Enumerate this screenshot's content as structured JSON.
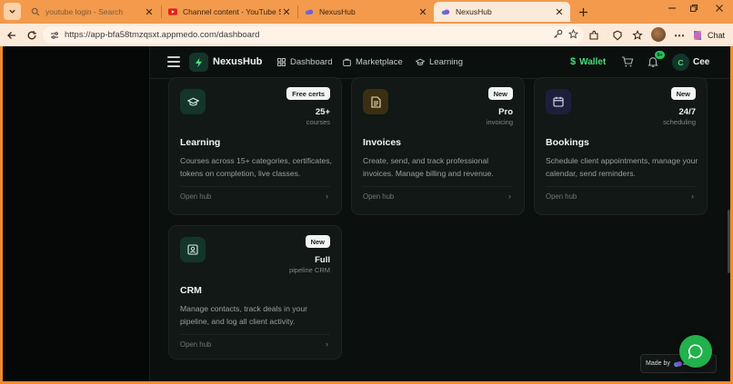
{
  "browser": {
    "tabs": [
      {
        "title": "youtube login - Search",
        "active": false
      },
      {
        "title": "Channel content - YouTube Studio",
        "active": false
      },
      {
        "title": "NexusHub",
        "active": false
      },
      {
        "title": "NexusHub",
        "active": true
      }
    ],
    "url": "https://app-bfa58tmzqsxt.appmedo.com/dashboard",
    "chat_label": "Chat"
  },
  "app": {
    "brand": "NexusHub",
    "nav": [
      {
        "label": "Dashboard",
        "icon": "dashboard-icon"
      },
      {
        "label": "Marketplace",
        "icon": "store-icon"
      },
      {
        "label": "Learning",
        "icon": "graduation-cap-icon"
      }
    ],
    "wallet_label": "Wallet",
    "notifications_badge": "9+",
    "user_initial": "C",
    "user_name": "Cee",
    "accent_color": "#4ade80"
  },
  "cards": [
    {
      "title": "Learning",
      "badge": "Free certs",
      "stat": "25+",
      "stat_sub": "courses",
      "description": "Courses across 15+ categories, certificates, tokens on completion, live classes.",
      "cta": "Open hub",
      "icon": "graduation-cap-icon"
    },
    {
      "title": "Invoices",
      "badge": "New",
      "stat": "Pro",
      "stat_sub": "invoicing",
      "description": "Create, send, and track professional invoices. Manage billing and revenue.",
      "cta": "Open hub",
      "icon": "document-icon"
    },
    {
      "title": "Bookings",
      "badge": "New",
      "stat": "24/7",
      "stat_sub": "scheduling",
      "description": "Schedule client appointments, manage your calendar, send reminders.",
      "cta": "Open hub",
      "icon": "calendar-icon"
    },
    {
      "title": "CRM",
      "badge": "New",
      "stat": "Full",
      "stat_sub": "pipeline CRM",
      "description": "Manage contacts, track deals in your pipeline, and log all client activity.",
      "cta": "Open hub",
      "icon": "contact-card-icon"
    }
  ],
  "footer": {
    "made_by": "Made by"
  }
}
